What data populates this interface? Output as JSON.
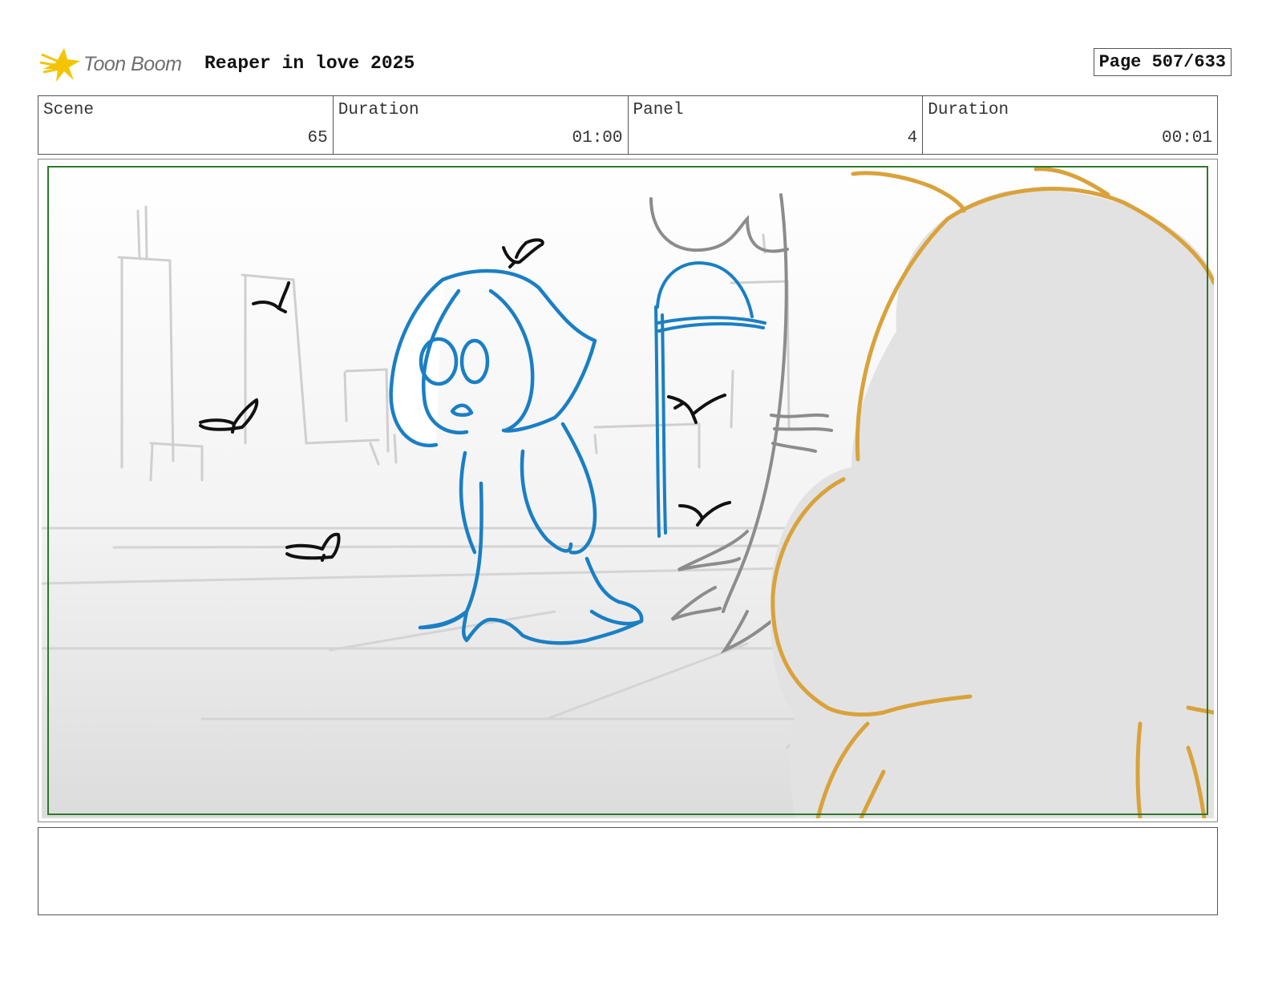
{
  "header": {
    "logo_text": "Toon Boom",
    "project_title": "Reaper in love 2025",
    "page_label": "Page 507/633"
  },
  "info": {
    "scene_label": "Scene",
    "scene_value": "65",
    "scene_duration_label": "Duration",
    "scene_duration_value": "01:00",
    "panel_label": "Panel",
    "panel_value": "4",
    "panel_duration_label": "Duration",
    "panel_duration_value": "00:01"
  },
  "colors": {
    "reaper_line": "#1a7fc4",
    "foreground_character": "#d9a23a",
    "safe_frame": "#2c7a2c",
    "logo_star": "#f5c400"
  },
  "icons": {
    "logo": "toon-boom-star-icon"
  },
  "notes": ""
}
